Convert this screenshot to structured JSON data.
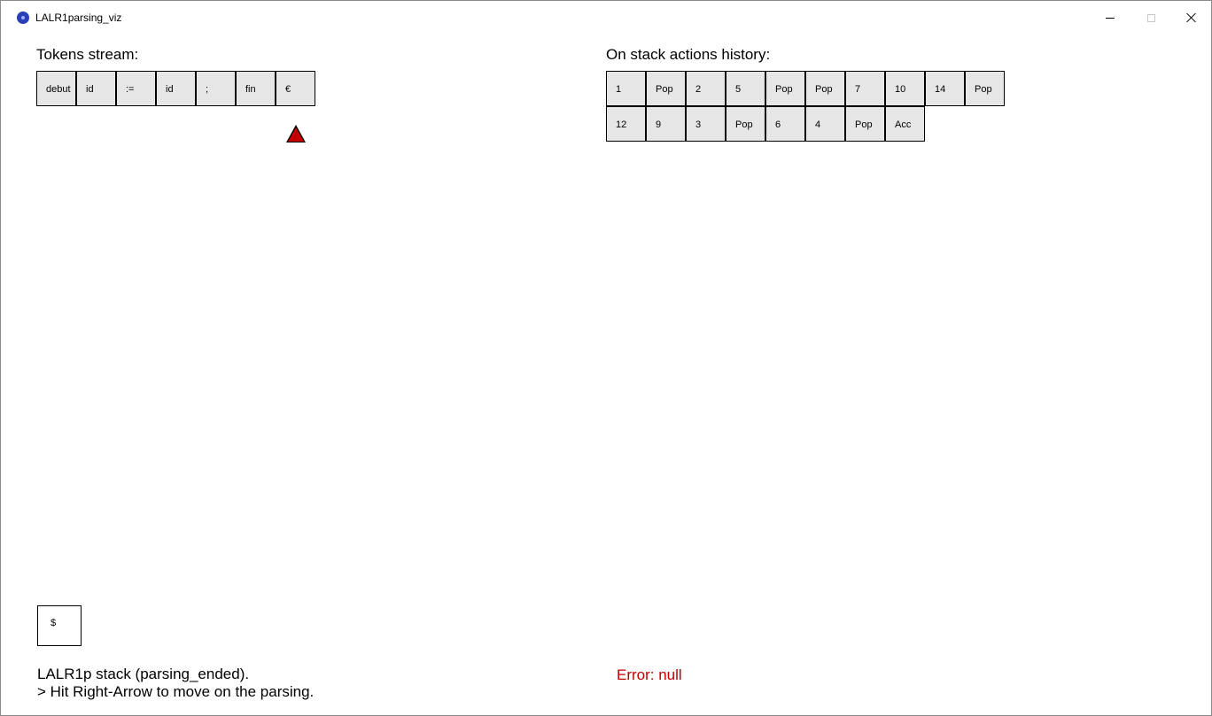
{
  "window": {
    "title": "LALR1parsing_viz"
  },
  "tokens": {
    "heading": "Tokens stream:",
    "items": [
      "debut",
      "id",
      ":=",
      "id",
      ";",
      "fin",
      "€"
    ]
  },
  "history": {
    "heading": "On stack actions history:",
    "row1": [
      "1",
      "Pop",
      "2",
      "5",
      "Pop",
      "Pop",
      "7",
      "10",
      "14",
      "Pop"
    ],
    "row2": [
      "12",
      "9",
      "3",
      "Pop",
      "6",
      "4",
      "Pop",
      "Acc"
    ]
  },
  "stack": {
    "items": [
      "$"
    ],
    "status": "LALR1p stack (parsing_ended).",
    "hint": "> Hit Right-Arrow to move on the parsing."
  },
  "error": {
    "text": "Error: null"
  },
  "colors": {
    "cell_fill": "#e6e6e6",
    "pointer": "#c40000",
    "error": "#c00000"
  }
}
